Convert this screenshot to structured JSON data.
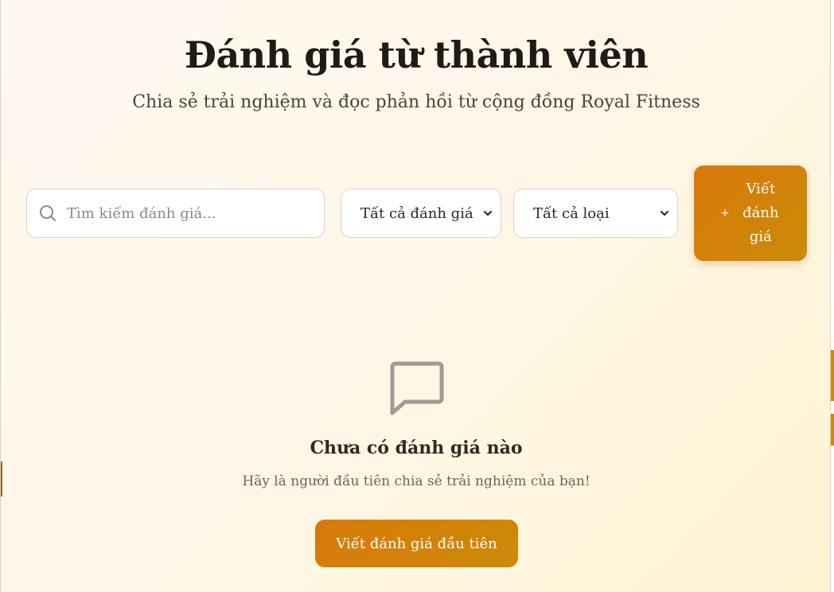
{
  "header": {
    "title": "Đánh giá từ thành viên",
    "subtitle": "Chia sẻ trải nghiệm và đọc phản hồi từ cộng đồng Royal Fitness"
  },
  "filters": {
    "search_placeholder": "Tìm kiếm đánh giá...",
    "rating_select": "Tất cả đánh giá",
    "type_select": "Tất cả loại"
  },
  "actions": {
    "write_review_plus": "+",
    "write_review_label": "Viết đánh giá"
  },
  "empty_state": {
    "title": "Chưa có đánh giá nào",
    "message": "Hãy là người đầu tiên chia sẻ trải nghiệm của bạn!",
    "button_label": "Viết đánh giá đầu tiên"
  },
  "icons": {
    "search": "search-icon",
    "chevron": "chevron-down-icon",
    "empty": "message-square-icon"
  },
  "colors": {
    "accent": "#d9790a",
    "accent_end": "#cc8b08",
    "title": "#1f1b17"
  }
}
